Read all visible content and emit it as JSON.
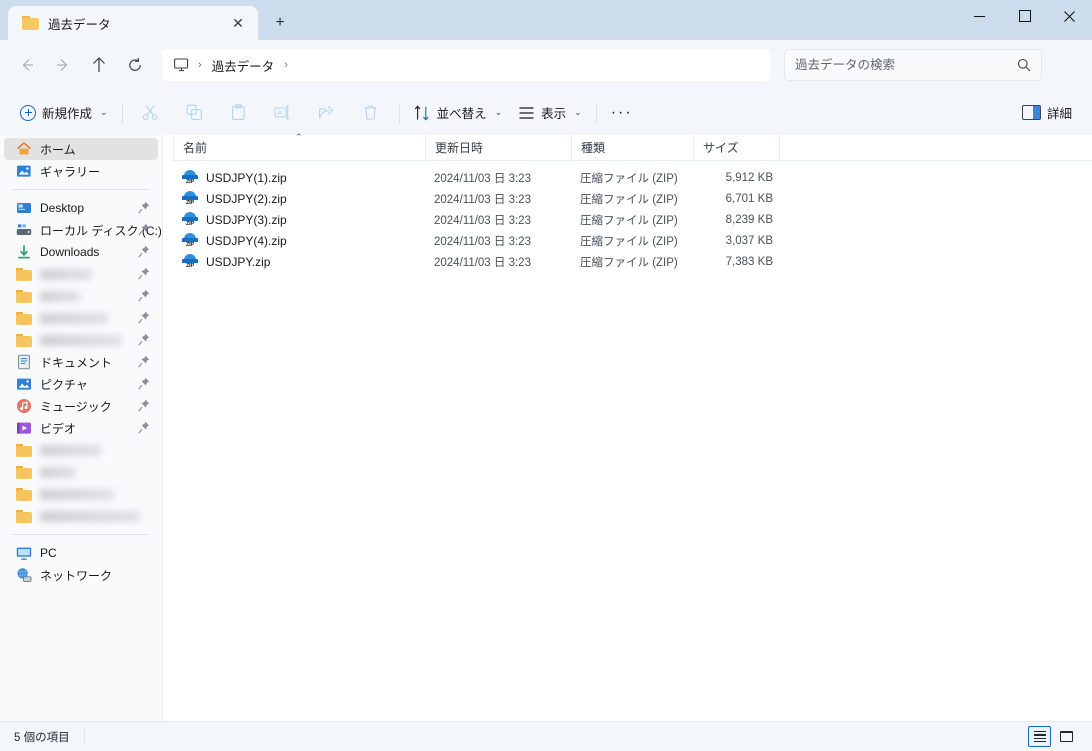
{
  "window": {
    "tab_title": "過去データ",
    "tab_close_label": "✕",
    "new_tab_label": "+",
    "minimize_label": "Minimize",
    "maximize_label": "Maximize",
    "close_label": "Close"
  },
  "nav": {
    "back_label": "←",
    "forward_label": "→",
    "up_label": "↑",
    "refresh_label": "⟳",
    "breadcrumb": {
      "root_icon": "this-pc-icon",
      "sep": "›",
      "path": "過去データ",
      "trailing_sep": "›"
    },
    "search": {
      "placeholder": "過去データの検索",
      "value": ""
    }
  },
  "toolbar": {
    "new_label": "新規作成",
    "cut_label": "切り取り",
    "copy_label": "コピー",
    "paste_label": "貼り付け",
    "rename_label": "名前の変更",
    "share_label": "共有",
    "delete_label": "削除",
    "sort_label": "並べ替え",
    "view_label": "表示",
    "more_label": "···",
    "details_label": "詳細",
    "chevron": "⌄"
  },
  "sidebar": {
    "items": [
      {
        "label": "ホーム",
        "icon": "home-icon",
        "selected": true,
        "pinned": false,
        "blurred": false
      },
      {
        "label": "ギャラリー",
        "icon": "gallery-icon",
        "selected": false,
        "pinned": false,
        "blurred": false
      },
      {
        "divider": true
      },
      {
        "label": "Desktop",
        "icon": "desktop-icon",
        "selected": false,
        "pinned": true,
        "blurred": false
      },
      {
        "label": "ローカル ディスク (C:)",
        "icon": "disk-icon",
        "selected": false,
        "pinned": true,
        "blurred": false
      },
      {
        "label": "Downloads",
        "icon": "downloads-icon",
        "selected": false,
        "pinned": true,
        "blurred": false
      },
      {
        "label": "",
        "icon": "folder-icon",
        "selected": false,
        "pinned": true,
        "blurred": true,
        "blur_width": 52
      },
      {
        "label": "",
        "icon": "folder-icon",
        "selected": false,
        "pinned": true,
        "blurred": true,
        "blur_width": 40
      },
      {
        "label": "",
        "icon": "folder-icon",
        "selected": false,
        "pinned": true,
        "blurred": true,
        "blur_width": 68
      },
      {
        "label": "",
        "icon": "folder-icon",
        "selected": false,
        "pinned": true,
        "blurred": true,
        "blur_width": 82
      },
      {
        "label": "ドキュメント",
        "icon": "documents-icon",
        "selected": false,
        "pinned": true,
        "blurred": false
      },
      {
        "label": "ピクチャ",
        "icon": "pictures-icon",
        "selected": false,
        "pinned": true,
        "blurred": false
      },
      {
        "label": "ミュージック",
        "icon": "music-icon",
        "selected": false,
        "pinned": true,
        "blurred": false
      },
      {
        "label": "ビデオ",
        "icon": "videos-icon",
        "selected": false,
        "pinned": true,
        "blurred": false
      },
      {
        "label": "",
        "icon": "folder-icon",
        "selected": false,
        "pinned": false,
        "blurred": true,
        "blur_width": 62
      },
      {
        "label": "",
        "icon": "folder-icon",
        "selected": false,
        "pinned": false,
        "blurred": true,
        "blur_width": 36
      },
      {
        "label": "",
        "icon": "folder-icon",
        "selected": false,
        "pinned": false,
        "blurred": true,
        "blur_width": 74
      },
      {
        "label": "",
        "icon": "folder-icon",
        "selected": false,
        "pinned": false,
        "blurred": true,
        "blur_width": 100
      },
      {
        "divider": true
      },
      {
        "label": "PC",
        "icon": "pc-icon",
        "selected": false,
        "pinned": false,
        "blurred": false
      },
      {
        "label": "ネットワーク",
        "icon": "network-icon",
        "selected": false,
        "pinned": false,
        "blurred": false
      }
    ]
  },
  "filelist": {
    "columns": {
      "name": "名前",
      "date": "更新日時",
      "type": "種類",
      "size": "サイズ"
    },
    "sort_indicator": "⌃",
    "rows": [
      {
        "name": "USDJPY(1).zip",
        "date": "2024/11/03 日 3:23",
        "type": "圧縮ファイル (ZIP)",
        "size": "5,912 KB",
        "icon": "zip-file-icon",
        "icon_text": "ZIP"
      },
      {
        "name": "USDJPY(2).zip",
        "date": "2024/11/03 日 3:23",
        "type": "圧縮ファイル (ZIP)",
        "size": "6,701 KB",
        "icon": "zip-file-icon",
        "icon_text": "ZIP"
      },
      {
        "name": "USDJPY(3).zip",
        "date": "2024/11/03 日 3:23",
        "type": "圧縮ファイル (ZIP)",
        "size": "8,239 KB",
        "icon": "zip-file-icon",
        "icon_text": "ZIP"
      },
      {
        "name": "USDJPY(4).zip",
        "date": "2024/11/03 日 3:23",
        "type": "圧縮ファイル (ZIP)",
        "size": "3,037 KB",
        "icon": "zip-file-icon",
        "icon_text": "ZIP"
      },
      {
        "name": "USDJPY.zip",
        "date": "2024/11/03 日 3:23",
        "type": "圧縮ファイル (ZIP)",
        "size": "7,383 KB",
        "icon": "zip-file-icon",
        "icon_text": "ZIP"
      }
    ]
  },
  "statusbar": {
    "item_count": "5 個の項目",
    "details_view_label": "詳細ビュー",
    "large_icons_view_label": "大アイコン ビュー"
  },
  "colors": {
    "titlebar_bg": "#cddcec",
    "chrome_bg": "#f3f7fb",
    "content_bg": "#ffffff",
    "accent": "#1668c0",
    "folder_yellow": "#f7c55f",
    "selected_row": "#e2e2e2"
  }
}
